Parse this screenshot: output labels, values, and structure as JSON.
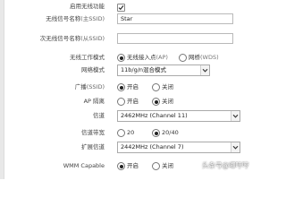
{
  "form": {
    "enable_wireless": {
      "label": "启用无线功能",
      "checked": true
    },
    "ssid_primary": {
      "label": "无线信号名称",
      "label_sub": "(主SSID)",
      "value": "Star"
    },
    "ssid_secondary": {
      "label": "次无线信号名称",
      "label_sub": "(从SSID)",
      "value": ""
    },
    "work_mode": {
      "label": "无线工作模式",
      "options": [
        {
          "text": "无线接入点",
          "sub": "(AP)",
          "selected": true
        },
        {
          "text": "网桥",
          "sub": "(WDS)",
          "selected": false
        }
      ]
    },
    "network_mode": {
      "label": "网络模式",
      "value": "11b/g/n混合模式"
    },
    "broadcast": {
      "label": "广播",
      "label_sub": "(SSID)",
      "options": [
        {
          "text": "开启",
          "selected": true
        },
        {
          "text": "关闭",
          "selected": false
        }
      ]
    },
    "ap_isolation": {
      "label": "AP 隔离",
      "options": [
        {
          "text": "开启",
          "selected": false
        },
        {
          "text": "关闭",
          "selected": true
        }
      ]
    },
    "channel": {
      "label": "信道",
      "value": "2462MHz (Channel 11)"
    },
    "bandwidth": {
      "label": "信道带宽",
      "options": [
        {
          "text": "20",
          "selected": false
        },
        {
          "text": "20/40",
          "selected": true
        }
      ]
    },
    "ext_channel": {
      "label": "扩展信道",
      "value": "2442MHz (Channel 7)"
    },
    "wmm": {
      "label": "WMM Capable",
      "options": [
        {
          "text": "开启",
          "selected": true
        },
        {
          "text": "关闭",
          "selected": false
        }
      ]
    }
  },
  "watermark": {
    "text": "头条号@唧哼哼"
  },
  "colors": {
    "accent": "#222222",
    "border": "#aaaaaa",
    "background": "#ffffff"
  }
}
